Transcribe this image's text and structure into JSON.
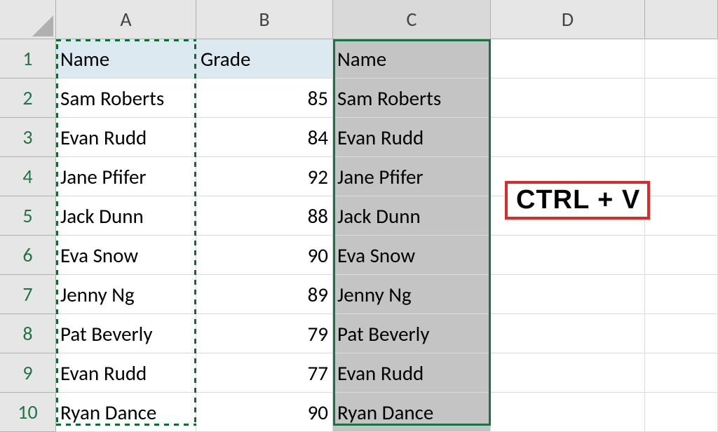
{
  "columns": [
    "A",
    "B",
    "C",
    "D"
  ],
  "row_numbers": [
    1,
    2,
    3,
    4,
    5,
    6,
    7,
    8,
    9,
    10
  ],
  "headers": {
    "a": "Name",
    "b": "Grade",
    "c": "Name"
  },
  "rows": [
    {
      "a": "Sam Roberts",
      "b": "85",
      "c": "Sam Roberts"
    },
    {
      "a": "Evan Rudd",
      "b": "84",
      "c": "Evan Rudd"
    },
    {
      "a": "Jane Pfifer",
      "b": "92",
      "c": "Jane Pfifer"
    },
    {
      "a": "Jack Dunn",
      "b": "88",
      "c": "Jack Dunn"
    },
    {
      "a": "Eva Snow",
      "b": "90",
      "c": "Eva Snow"
    },
    {
      "a": "Jenny Ng",
      "b": "89",
      "c": "Jenny Ng"
    },
    {
      "a": "Pat Beverly",
      "b": "79",
      "c": "Pat Beverly"
    },
    {
      "a": "Evan Rudd",
      "b": "77",
      "c": "Evan Rudd"
    },
    {
      "a": "Ryan Dance",
      "b": "90",
      "c": "Ryan Dance"
    }
  ],
  "annotation": "CTRL + V"
}
